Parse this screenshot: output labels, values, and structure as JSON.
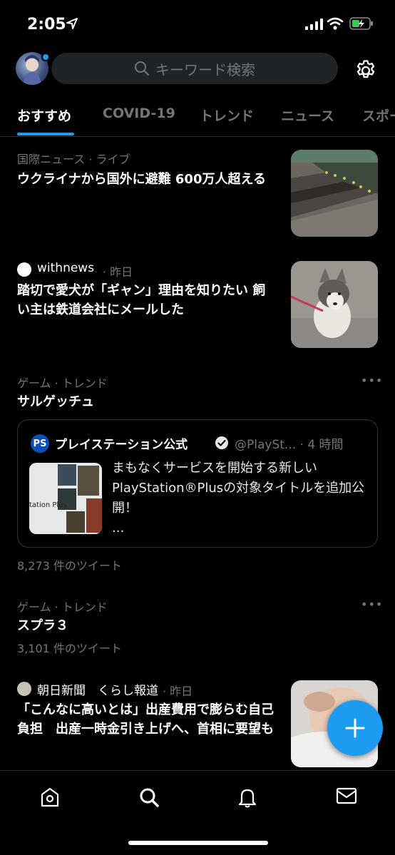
{
  "status_bar": {
    "time": "2:05"
  },
  "search": {
    "placeholder": "キーワード検索"
  },
  "tabs": [
    {
      "label": "おすすめ"
    },
    {
      "label": "COVID-19"
    },
    {
      "label": "トレンド"
    },
    {
      "label": "ニュース"
    },
    {
      "label": "スポー"
    }
  ],
  "feed": {
    "item1": {
      "category": "国際ニュース · ライブ",
      "headline": "ウクライナから国外に避難 600万人超える"
    },
    "item2": {
      "source": "withnews",
      "time": "· 昨日",
      "headline": "踏切で愛犬が「ギャン」理由を知りたい 飼い主は鉄道会社にメールした"
    },
    "trend1": {
      "category": "ゲーム · トレンド",
      "title": "サルゲッチュ",
      "tweet_count": "8,273 件のツイート",
      "embed": {
        "logo_text": "PS",
        "name": "プレイステーション公式",
        "handle": "@PlaySt... · 4 時間",
        "image_label": "tation Plus",
        "text": "まもなくサービスを開始する新しいPlayStation®Plusの対象タイトルを追加公開！",
        "more": "..."
      }
    },
    "trend2": {
      "category": "ゲーム · トレンド",
      "title": "スプラ３",
      "tweet_count": "3,101 件のツイート"
    },
    "item3": {
      "source": "朝日新聞　くらし報道",
      "time": "· 昨日",
      "headline": "「こんなに高いとは」出産費用で膨らむ自己負担　出産一時金引き上げへ、首相に要望も"
    }
  },
  "colors": {
    "accent": "#1d9bf0",
    "background": "#000000",
    "muted": "#71767b"
  },
  "icons": [
    "location-arrow-icon",
    "signal-icon",
    "wifi-icon",
    "battery-icon",
    "search-icon",
    "gear-icon",
    "more-icon",
    "verified-icon",
    "plus-icon",
    "home-icon",
    "explore-icon",
    "bell-icon",
    "mail-icon"
  ]
}
